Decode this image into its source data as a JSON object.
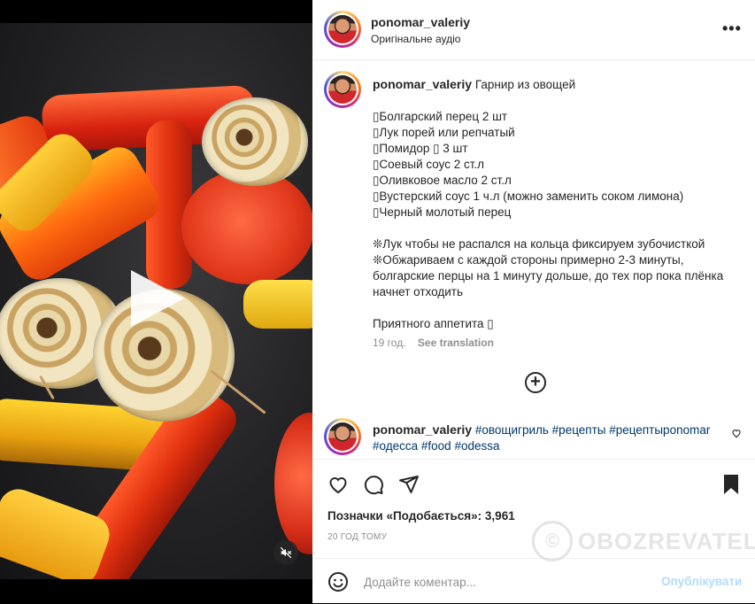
{
  "header": {
    "username": "ponomar_valeriy",
    "audio": "Оригінальне аудіо",
    "more_icon": "more-horizontal-icon"
  },
  "caption": {
    "username": "ponomar_valeriy",
    "title": "Гарнир из овощей",
    "lines": [
      "▯Болгарский перец 2 шт",
      "▯Лук порей или репчатый",
      "▯Помидор ▯ 3 шт",
      "▯Соевый соус 2 ст.л",
      "▯Оливковое масло 2 ст.л",
      "▯Вустерский соус 1 ч.л (можно заменить соком лимона)",
      "▯Черный молотый перец"
    ],
    "notes": [
      "❊Лук чтобы не распался на кольца фиксируем зубочисткой",
      "❊Обжариваем с каждой стороны примерно 2-3 минуты, болгарские перцы на 1 минуту дольше, до тех пор пока плёнка начнет отходить"
    ],
    "closing": "Приятного аппетита ▯",
    "age": "19 год.",
    "see_translation": "See translation"
  },
  "comment": {
    "username": "ponomar_valeriy",
    "tags": [
      "#овощигриль",
      "#рецепты",
      "#рецептыponomar",
      "#одесса",
      "#food",
      "#odessa"
    ]
  },
  "actions": {
    "likes_label": "Позначки «Подобається»:",
    "likes_count": "3,961",
    "timestamp": "20 ГОД ТОМУ"
  },
  "add_comment": {
    "placeholder": "Додайте коментар...",
    "post_label": "Опублікувати"
  },
  "watermark": {
    "text": "OBOZREVATEL"
  },
  "colors": {
    "link": "#00376b",
    "post_disabled": "#b3dbff",
    "muted": "#8e8e8e"
  }
}
